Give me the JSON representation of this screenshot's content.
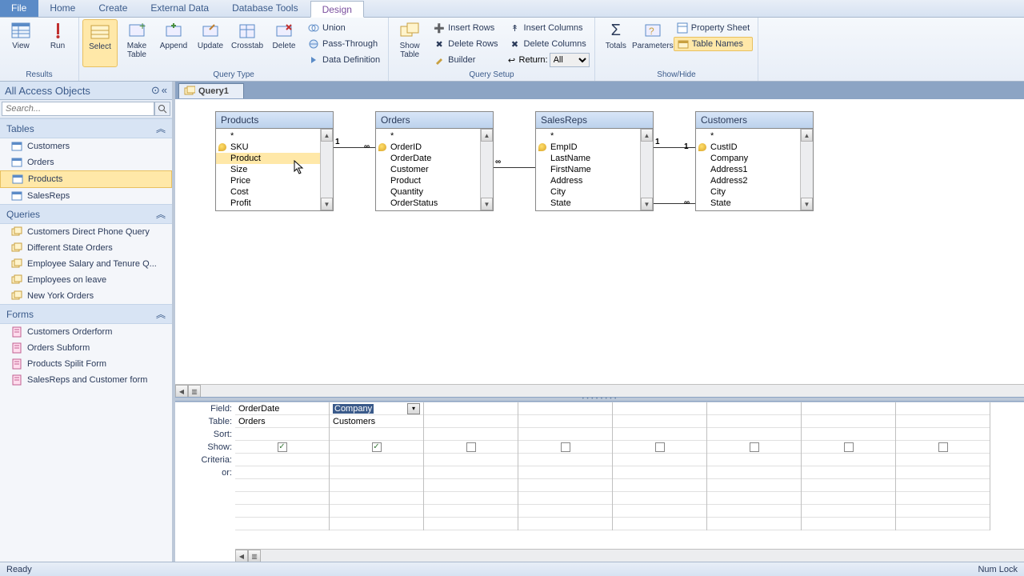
{
  "tabs": [
    "File",
    "Home",
    "Create",
    "External Data",
    "Database Tools",
    "Design"
  ],
  "active_tab": "Design",
  "ribbon": {
    "results": {
      "label": "Results",
      "view": "View",
      "run": "Run"
    },
    "query_type": {
      "label": "Query Type",
      "select": "Select",
      "make_table": "Make\nTable",
      "append": "Append",
      "update": "Update",
      "crosstab": "Crosstab",
      "delete": "Delete",
      "union": "Union",
      "pass_through": "Pass-Through",
      "data_definition": "Data Definition"
    },
    "query_setup": {
      "label": "Query Setup",
      "show_table": "Show\nTable",
      "insert_rows": "Insert Rows",
      "delete_rows": "Delete Rows",
      "builder": "Builder",
      "insert_columns": "Insert Columns",
      "delete_columns": "Delete Columns",
      "return": "Return:",
      "return_value": "All"
    },
    "show_hide": {
      "label": "Show/Hide",
      "totals": "Totals",
      "parameters": "Parameters",
      "property_sheet": "Property Sheet",
      "table_names": "Table Names"
    }
  },
  "nav": {
    "title": "All Access Objects",
    "search_placeholder": "Search...",
    "sections": {
      "tables": {
        "label": "Tables",
        "items": [
          "Customers",
          "Orders",
          "Products",
          "SalesReps"
        ]
      },
      "queries": {
        "label": "Queries",
        "items": [
          "Customers Direct Phone Query",
          "Different State Orders",
          "Employee Salary and Tenure Q...",
          "Employees on leave",
          "New York Orders"
        ]
      },
      "forms": {
        "label": "Forms",
        "items": [
          "Customers Orderform",
          "Orders Subform",
          "Products Spilit Form",
          "SalesReps and Customer form"
        ]
      }
    },
    "selected": "Products"
  },
  "query_tab": "Query1",
  "tables": {
    "products": {
      "title": "Products",
      "fields": [
        "*",
        "SKU",
        "Product",
        "Size",
        "Price",
        "Cost",
        "Profit"
      ],
      "pk": "SKU",
      "highlight": "Product"
    },
    "orders": {
      "title": "Orders",
      "fields": [
        "*",
        "OrderID",
        "OrderDate",
        "Customer",
        "Product",
        "Quantity",
        "OrderStatus"
      ],
      "pk": "OrderID"
    },
    "salesreps": {
      "title": "SalesReps",
      "fields": [
        "*",
        "EmpID",
        "LastName",
        "FirstName",
        "Address",
        "City",
        "State"
      ],
      "pk": "EmpID"
    },
    "customers": {
      "title": "Customers",
      "fields": [
        "*",
        "CustID",
        "Company",
        "Address1",
        "Address2",
        "City",
        "State"
      ],
      "pk": "CustID"
    }
  },
  "grid": {
    "row_labels": [
      "Field:",
      "Table:",
      "Sort:",
      "Show:",
      "Criteria:",
      "or:"
    ],
    "columns": [
      {
        "field": "OrderDate",
        "table": "Orders",
        "show": true
      },
      {
        "field": "Company",
        "table": "Customers",
        "show": true,
        "selected": true
      },
      {
        "show": false
      },
      {
        "show": false
      },
      {
        "show": false
      },
      {
        "show": false
      },
      {
        "show": false
      },
      {
        "show": false
      }
    ]
  },
  "status": {
    "ready": "Ready",
    "numlock": "Num Lock"
  }
}
